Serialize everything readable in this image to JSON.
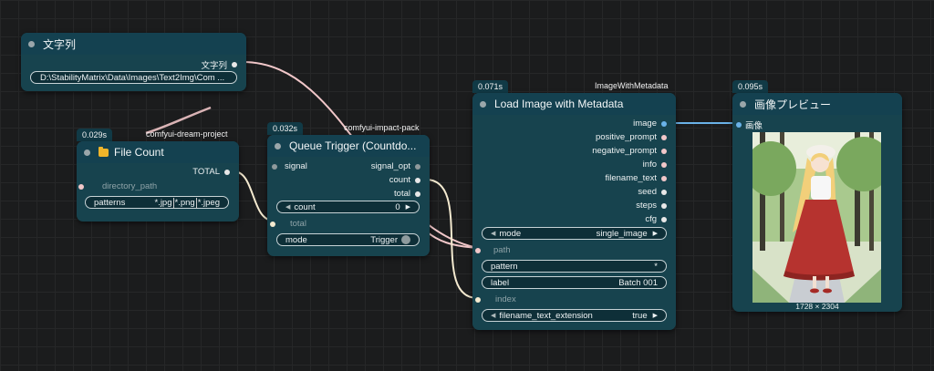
{
  "nodes": {
    "string": {
      "title": "文字列",
      "output_label": "文字列",
      "value": "D:\\StabilityMatrix\\Data\\Images\\Text2Img\\Com ..."
    },
    "file_count": {
      "time": "0.029s",
      "source": "comfyui-dream-project",
      "title": "File Count",
      "output_label": "TOTAL",
      "input_label": "directory_path",
      "patterns_label": "patterns",
      "patterns_values": [
        "*.jpg",
        "*.png",
        "*.jpeg"
      ]
    },
    "queue_trigger": {
      "time": "0.032s",
      "source": "comfyui-impact-pack",
      "title": "Queue Trigger (Countdo...",
      "input_signal": "signal",
      "outputs": [
        "signal_opt",
        "count",
        "total"
      ],
      "count_label": "count",
      "count_value": "0",
      "total_label": "total",
      "mode_label": "mode",
      "mode_value": "Trigger"
    },
    "load_image": {
      "time": "0.071s",
      "source": "ImageWithMetadata",
      "title": "Load Image with Metadata",
      "outputs": [
        "image",
        "positive_prompt",
        "negative_prompt",
        "info",
        "filename_text",
        "seed",
        "steps",
        "cfg"
      ],
      "mode_label": "mode",
      "mode_value": "single_image",
      "path_label": "path",
      "pattern_label": "pattern",
      "pattern_value": "*",
      "label_label": "label",
      "label_value": "Batch 001",
      "index_label": "index",
      "ext_label": "filename_text_extension",
      "ext_value": "true"
    },
    "preview": {
      "time": "0.095s",
      "title": "画像プレビュー",
      "input_label": "画像",
      "resolution": "1728 × 2304"
    }
  },
  "colors": {
    "node_body": "#17434e",
    "node_header": "#144150",
    "wire_string": "#f1c7c9",
    "wire_int": "#f4ead0",
    "wire_image": "#6ab2e8"
  },
  "icons": [
    "folder-icon"
  ]
}
